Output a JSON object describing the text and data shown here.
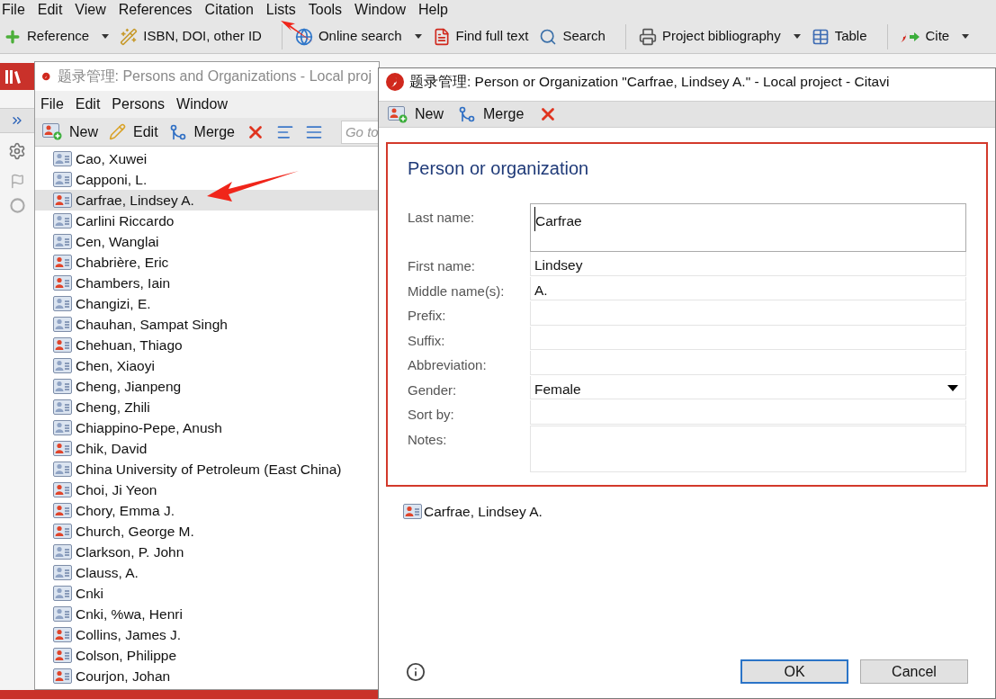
{
  "main_window": {
    "menu": [
      "File",
      "Edit",
      "View",
      "References",
      "Citation",
      "Lists",
      "Tools",
      "Window",
      "Help"
    ],
    "toolbar": [
      {
        "kind": "add",
        "label": "Reference",
        "dropdown": true,
        "separator_before": false
      },
      {
        "kind": "wand",
        "label": "ISBN, DOI, other ID",
        "dropdown": false,
        "separator_before": false
      },
      {
        "kind": "globe",
        "label": "Online search",
        "dropdown": true,
        "separator_before": true
      },
      {
        "kind": "pdf",
        "label": "Find full text",
        "dropdown": false,
        "separator_before": false
      },
      {
        "kind": "search",
        "label": "Search",
        "dropdown": false,
        "separator_before": false
      },
      {
        "kind": "print",
        "label": "Project bibliography",
        "dropdown": true,
        "separator_before": true
      },
      {
        "kind": "table",
        "label": "Table",
        "dropdown": false,
        "separator_before": false
      },
      {
        "kind": "cite",
        "label": "Cite",
        "dropdown": true,
        "separator_before": true
      }
    ]
  },
  "persons_window": {
    "title": "题录管理: Persons and Organizations - Local proj",
    "menu": [
      "File",
      "Edit",
      "Persons",
      "Window"
    ],
    "toolbar": [
      {
        "kind": "new",
        "label": "New"
      },
      {
        "kind": "edit",
        "label": "Edit"
      },
      {
        "kind": "merge",
        "label": "Merge"
      },
      {
        "kind": "delete"
      },
      {
        "kind": "expand"
      },
      {
        "kind": "collapse"
      }
    ],
    "goto_placeholder": "Go to",
    "persons": [
      {
        "name": "Cao, Xuwei",
        "kind": "plain",
        "selected": false
      },
      {
        "name": "Capponi, L.",
        "kind": "plain",
        "selected": false
      },
      {
        "name": "Carfrae, Lindsey A.",
        "kind": "marked",
        "selected": true
      },
      {
        "name": "Carlini Riccardo",
        "kind": "plain",
        "selected": false
      },
      {
        "name": "Cen, Wanglai",
        "kind": "plain",
        "selected": false
      },
      {
        "name": "Chabrière, Eric",
        "kind": "marked",
        "selected": false
      },
      {
        "name": "Chambers, Iain",
        "kind": "marked",
        "selected": false
      },
      {
        "name": "Changizi, E.",
        "kind": "plain",
        "selected": false
      },
      {
        "name": "Chauhan, Sampat Singh",
        "kind": "plain",
        "selected": false
      },
      {
        "name": "Chehuan, Thiago",
        "kind": "marked",
        "selected": false
      },
      {
        "name": "Chen, Xiaoyi",
        "kind": "plain",
        "selected": false
      },
      {
        "name": "Cheng, Jianpeng",
        "kind": "plain",
        "selected": false
      },
      {
        "name": "Cheng, Zhili",
        "kind": "plain",
        "selected": false
      },
      {
        "name": "Chiappino-Pepe, Anush",
        "kind": "plain",
        "selected": false
      },
      {
        "name": "Chik, David",
        "kind": "marked",
        "selected": false
      },
      {
        "name": "China University of Petroleum (East China)",
        "kind": "plain",
        "selected": false
      },
      {
        "name": "Choi, Ji Yeon",
        "kind": "marked",
        "selected": false
      },
      {
        "name": "Chory, Emma J.",
        "kind": "marked",
        "selected": false
      },
      {
        "name": "Church, George M.",
        "kind": "marked",
        "selected": false
      },
      {
        "name": "Clarkson, P. John",
        "kind": "plain",
        "selected": false
      },
      {
        "name": "Clauss, A.",
        "kind": "plain",
        "selected": false
      },
      {
        "name": "Cnki",
        "kind": "plain",
        "selected": false
      },
      {
        "name": "Cnki, %wa, Henri",
        "kind": "plain",
        "selected": false
      },
      {
        "name": "Collins, James J.",
        "kind": "marked",
        "selected": false
      },
      {
        "name": "Colson, Philippe",
        "kind": "marked",
        "selected": false
      },
      {
        "name": "Courjon, Johan",
        "kind": "marked",
        "selected": false
      }
    ]
  },
  "person_dialog": {
    "title": "题录管理: Person or Organization \"Carfrae, Lindsey A.\" - Local project - Citavi",
    "toolbar": [
      {
        "kind": "new",
        "label": "New"
      },
      {
        "kind": "merge",
        "label": "Merge"
      },
      {
        "kind": "delete"
      }
    ],
    "heading": "Person or organization",
    "fields": [
      {
        "label": "Last name:",
        "value": "Carfrae",
        "kind": "tall"
      },
      {
        "label": "First name:",
        "value": "Lindsey",
        "kind": "line"
      },
      {
        "label": "Middle name(s):",
        "value": "A.",
        "kind": "line"
      },
      {
        "label": "Prefix:",
        "kind": "line"
      },
      {
        "label": "Suffix:",
        "kind": "line"
      },
      {
        "label": "Abbreviation:",
        "kind": "line"
      },
      {
        "label": "Gender:",
        "value": "Female",
        "kind": "select"
      },
      {
        "label": "Sort by:",
        "kind": "line"
      },
      {
        "label": "Notes:",
        "kind": "area"
      }
    ],
    "preview": {
      "name": "Carfrae, Lindsey A.",
      "kind": "marked"
    },
    "buttons": [
      {
        "label": "OK",
        "default": true
      },
      {
        "label": "Cancel",
        "default": false
      }
    ]
  }
}
